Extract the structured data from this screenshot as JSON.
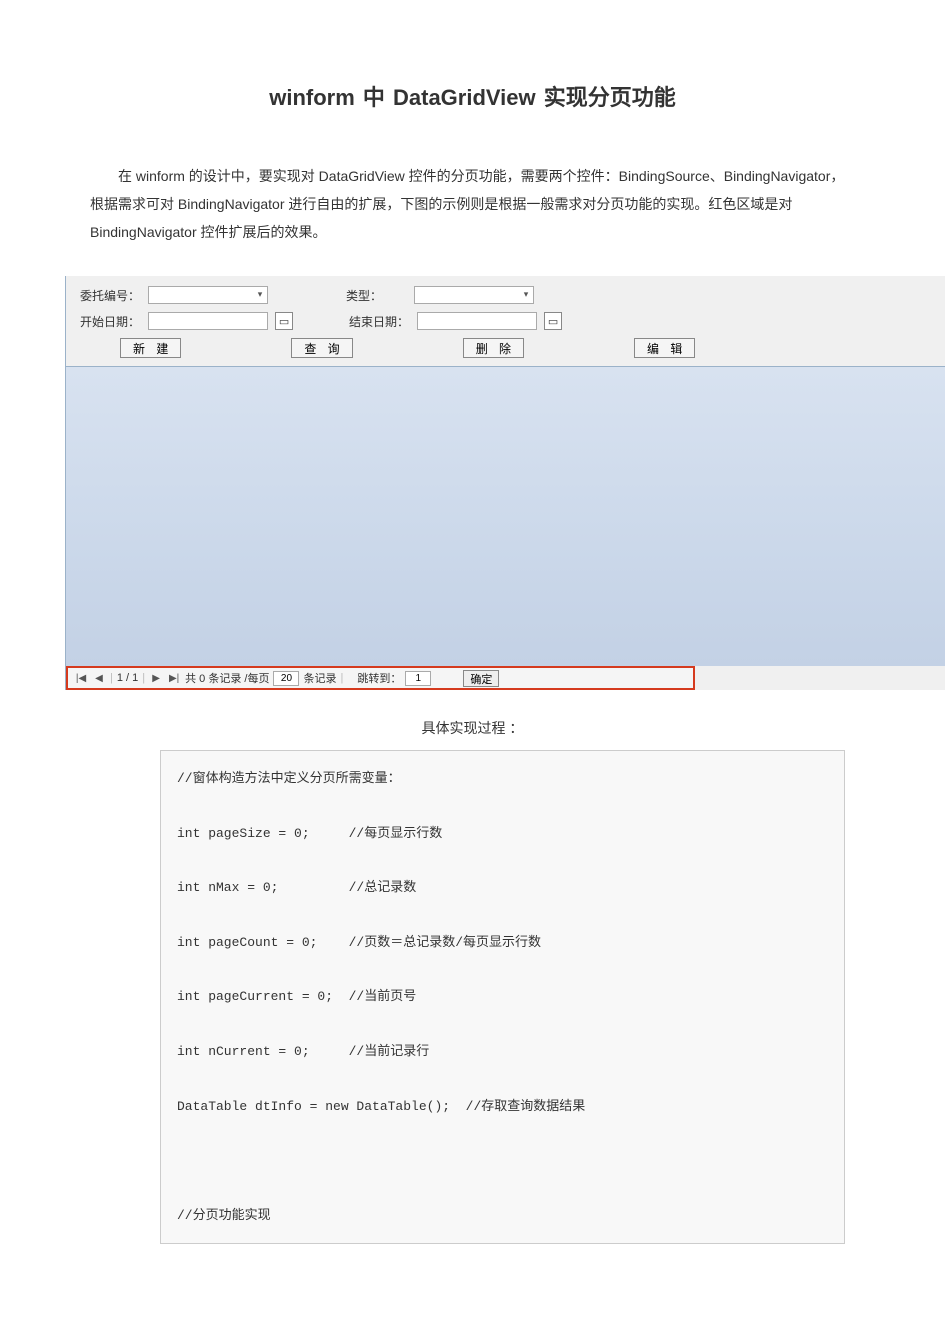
{
  "title": "winform 中 DataGridView 实现分页功能",
  "intro": "在 winform 的设计中，要实现对 DataGridView 控件的分页功能，需要两个控件：BindingSource、BindingNavigator，根据需求可对 BindingNavigator 进行自由的扩展，下图的示例则是根据一般需求对分页功能的实现。红色区域是对 BindingNavigator 控件扩展后的效果。",
  "form": {
    "id_label": "委托编号：",
    "id_value": "",
    "type_label": "类型：",
    "type_value": "",
    "start_label": "开始日期：",
    "start_value": "",
    "end_label": "结束日期：",
    "end_value": "",
    "btn_new": "新 建",
    "btn_query": "查 询",
    "btn_delete": "删 除",
    "btn_edit": "编 辑"
  },
  "pager": {
    "first": "|◀",
    "prev": "◀",
    "pos": "1 / 1",
    "next": "▶",
    "last": "▶|",
    "total_prefix": "共 0 条记录 /每页",
    "page_size": "20",
    "total_suffix": "条记录",
    "jump_label": "跳转到：",
    "jump_value": "1",
    "ok": "确定"
  },
  "impl_head": "具体实现过程 ：",
  "code_lines": [
    "//窗体构造方法中定义分页所需变量：",
    "",
    "int pageSize = 0;     //每页显示行数",
    "",
    "int nMax = 0;         //总记录数",
    "",
    "int pageCount = 0;    //页数＝总记录数/每页显示行数",
    "",
    "int pageCurrent = 0;  //当前页号",
    "",
    "int nCurrent = 0;     //当前记录行",
    "",
    "DataTable dtInfo = new DataTable();  //存取查询数据结果",
    "",
    "",
    "",
    "//分页功能实现"
  ]
}
